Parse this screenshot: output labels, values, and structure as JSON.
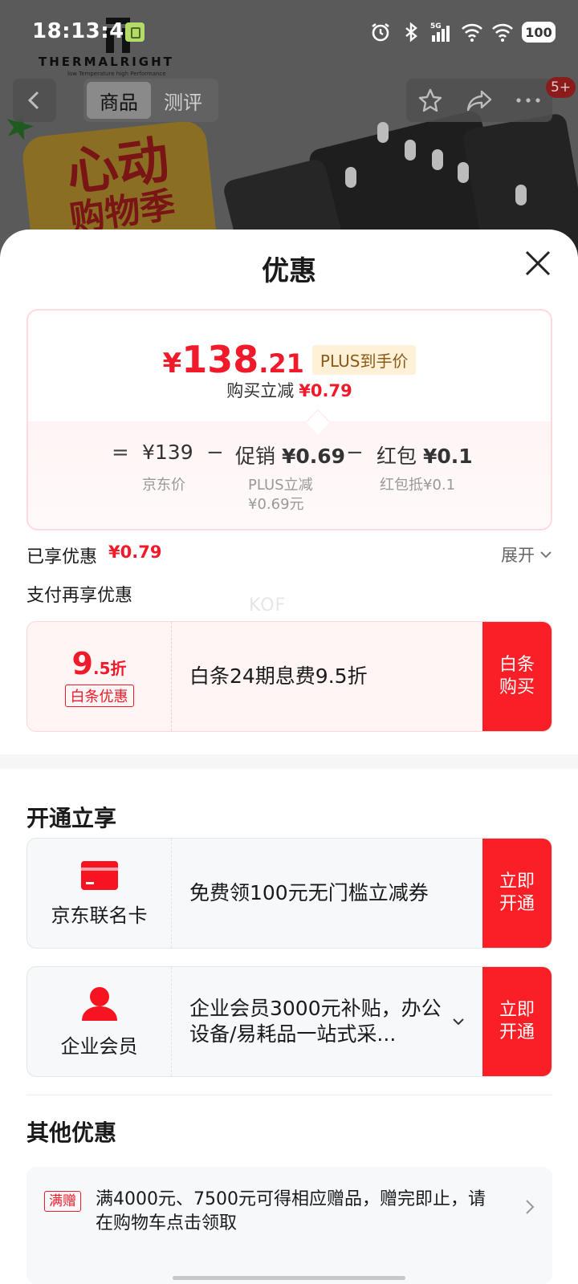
{
  "status_bar": {
    "time": "18:13:44",
    "network": "5G",
    "battery": "100"
  },
  "background": {
    "brand_name": "THERMALRIGHT",
    "brand_tagline": "low Temperature high Performance",
    "promo_line1": "心动",
    "promo_line2": "购物季"
  },
  "top_nav": {
    "tabs": [
      "商品",
      "测评"
    ],
    "active_tab": 0,
    "badge": "5+"
  },
  "sheet": {
    "title": "优惠",
    "final_price": {
      "currency": "¥",
      "integer": "138",
      "decimal": ".21",
      "plus_tag": "PLUS到手价",
      "sub_label": "购买立减",
      "sub_amount": "¥0.79"
    },
    "breakdown": {
      "eq": "=",
      "minus": "−",
      "jd_price": "¥139",
      "jd_caption": "京东价",
      "promo_label": "促销",
      "promo_amount": "¥0.69",
      "promo_caption_1": "PLUS立减",
      "promo_caption_2": "¥0.69元",
      "redpack_label": "红包",
      "redpack_amount": "¥0.1",
      "redpack_caption": "红包抵¥0.1"
    },
    "enjoyed": {
      "label": "已享优惠",
      "amount": "¥0.79",
      "expand": "展开"
    },
    "pay_more_label": "支付再享优惠",
    "watermark": "KOF",
    "baitiao": {
      "discount_big": "9",
      "discount_small": ".5折",
      "tag": "白条优惠",
      "text": "白条24期息费9.5折",
      "button_line1": "白条",
      "button_line2": "购买"
    },
    "open_section": {
      "title": "开通立享",
      "items": [
        {
          "icon": "credit-card-icon",
          "caption": "京东联名卡",
          "text": "免费领100元无门槛立减券",
          "button_line1": "立即",
          "button_line2": "开通"
        },
        {
          "icon": "person-icon",
          "caption": "企业会员",
          "text": "企业会员3000元补贴，办公设备/易耗品一站式采...",
          "button_line1": "立即",
          "button_line2": "开通"
        }
      ]
    },
    "other_section": {
      "title": "其他优惠",
      "items": [
        {
          "tag": "满赠",
          "text": "满4000元、7500元可得相应赠品，赠完即止，请在购物车点击领取"
        }
      ]
    }
  },
  "colors": {
    "accent_red": "#fa1f26",
    "price_red": "#f01a2a",
    "plus_tag_bg": "#fff1d8"
  }
}
